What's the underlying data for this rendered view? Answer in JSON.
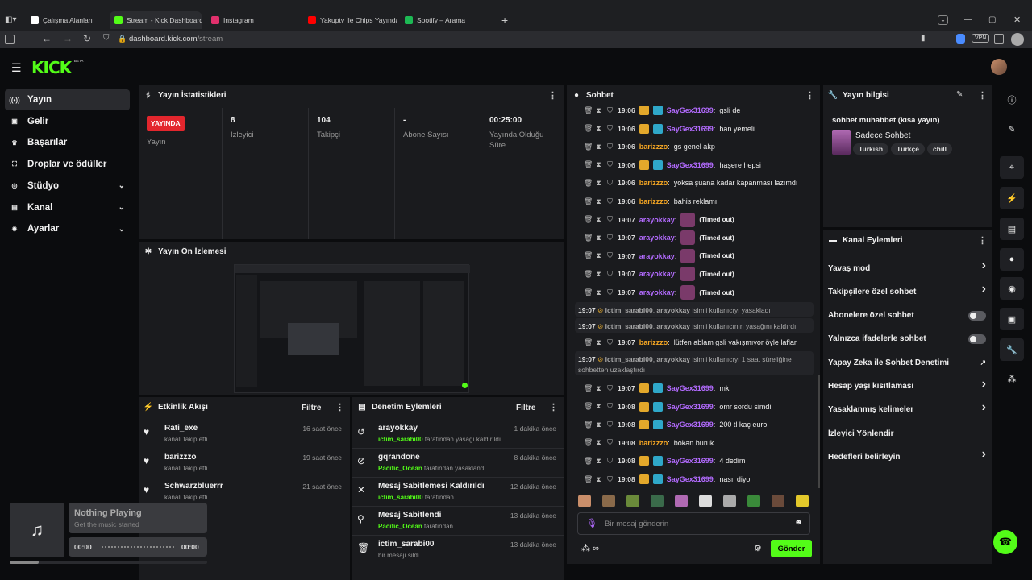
{
  "browser": {
    "tabs": [
      {
        "label": "Çalışma Alanları",
        "color": "#ffffff"
      },
      {
        "label": "Stream - Kick Dashboard",
        "color": "#53fc18"
      },
      {
        "label": "Instagram",
        "color": "#e1306c"
      },
      {
        "label": "Yakuptv İle Chips Yayında K",
        "color": "#ff0000"
      },
      {
        "label": "Spotify – Arama",
        "color": "#1db954"
      }
    ],
    "url_host": "dashboard.kick.com",
    "url_path": "/stream",
    "new_tab": "+",
    "vpn": "VPN"
  },
  "brand": {
    "logo": "KICK",
    "beta": "BETA",
    "accent": "#53fc18"
  },
  "sidebar": {
    "items": [
      {
        "label": "Yayın",
        "icon": "broadcast-icon",
        "glyph": "((•))"
      },
      {
        "label": "Gelir",
        "icon": "revenue-icon",
        "glyph": "▣"
      },
      {
        "label": "Başarılar",
        "icon": "trophy-icon",
        "glyph": "♛"
      },
      {
        "label": "Droplar ve ödüller",
        "icon": "gift-icon",
        "glyph": "⛶"
      },
      {
        "label": "Stüdyo",
        "icon": "studio-icon",
        "glyph": "◎"
      },
      {
        "label": "Kanal",
        "icon": "channel-icon",
        "glyph": "▤"
      },
      {
        "label": "Ayarlar",
        "icon": "settings-icon",
        "glyph": "✹"
      }
    ]
  },
  "stats": {
    "title": "Yayın İstatistikleri",
    "live_badge": "YAYINDA",
    "live_label": "Yayın",
    "items": [
      {
        "value": "8",
        "label": "İzleyici"
      },
      {
        "value": "104",
        "label": "Takipçi"
      },
      {
        "value": "-",
        "label": "Abone Sayısı"
      },
      {
        "value": "00:25:00",
        "label": "Yayında Olduğu Süre"
      }
    ]
  },
  "preview": {
    "title": "Yayın Ön İzlemesi"
  },
  "activity": {
    "title": "Etkinlik Akışı",
    "filter": "Filtre",
    "items": [
      {
        "name": "Rati_exe",
        "sub": "kanalı takip etti",
        "time": "16 saat önce"
      },
      {
        "name": "barizzzo",
        "sub": "kanalı takip etti",
        "time": "19 saat önce"
      },
      {
        "name": "Schwarzbluerrr",
        "sub": "kanalı takip etti",
        "time": "21 saat önce"
      }
    ]
  },
  "moderation": {
    "title": "Denetim Eylemleri",
    "filter": "Filtre",
    "items": [
      {
        "name": "arayokkay",
        "actor": "ictim_sarabi00",
        "sub": "tarafından yasağı kaldırıldı",
        "time": "1 dakika önce",
        "glyph": "↺"
      },
      {
        "name": "gqrandone",
        "actor": "Pacific_Ocean",
        "sub": "tarafından yasaklandı",
        "time": "8 dakika önce",
        "glyph": "⊘"
      },
      {
        "name": "Mesaj Sabitlemesi Kaldırıldı",
        "actor": "ictim_sarabi00",
        "sub": "tarafından",
        "time": "12 dakika önce",
        "glyph": "✕"
      },
      {
        "name": "Mesaj Sabitlendi",
        "actor": "Pacific_Ocean",
        "sub": "tarafından",
        "time": "13 dakika önce",
        "glyph": "⚲"
      },
      {
        "name": "ictim_sarabi00",
        "actor": "",
        "sub": "bir mesajı sildi",
        "time": "13 dakika önce",
        "glyph": "🗑"
      }
    ]
  },
  "chat": {
    "title": "Sohbet",
    "input_placeholder": "Bir mesaj gönderin",
    "send": "Gönder",
    "lines": [
      {
        "time": "19:06",
        "user": "SayGex31699",
        "color": "#b36bff",
        "badges": true,
        "msg": "gsli de"
      },
      {
        "time": "19:06",
        "user": "SayGex31699",
        "color": "#b36bff",
        "badges": true,
        "msg": "ban yemeli"
      },
      {
        "time": "19:06",
        "user": "barizzzo",
        "color": "#f5a623",
        "badges": false,
        "msg": "gs genel akp"
      },
      {
        "time": "19:06",
        "user": "SayGex31699",
        "color": "#b36bff",
        "badges": true,
        "msg": "haşere hepsi"
      },
      {
        "time": "19:06",
        "user": "barizzzo",
        "color": "#f5a623",
        "badges": false,
        "msg": "yoksa şuana kadar kapanması lazımdı"
      },
      {
        "time": "19:06",
        "user": "barizzzo",
        "color": "#f5a623",
        "badges": false,
        "msg": "bahis reklamı"
      },
      {
        "time": "19:07",
        "user": "arayokkay",
        "color": "#b36bff",
        "badges": false,
        "msg": "(Timed out)",
        "timed": true
      },
      {
        "time": "19:07",
        "user": "arayokkay",
        "color": "#b36bff",
        "badges": false,
        "msg": "(Timed out)",
        "timed": true
      },
      {
        "time": "19:07",
        "user": "arayokkay",
        "color": "#b36bff",
        "badges": false,
        "msg": "(Timed out)",
        "timed": true
      },
      {
        "time": "19:07",
        "user": "arayokkay",
        "color": "#b36bff",
        "badges": false,
        "msg": "(Timed out)",
        "timed": true
      },
      {
        "time": "19:07",
        "user": "arayokkay",
        "color": "#b36bff",
        "badges": false,
        "msg": "(Timed out)",
        "timed": true
      }
    ],
    "sys1": {
      "time": "19:07",
      "actor": "ictim_sarabi00",
      "target": "arayokkay",
      "text": "isimli kullanıcıyı yasakladı"
    },
    "sys2": {
      "time": "19:07",
      "actor": "ictim_sarabi00",
      "target": "arayokkay",
      "text": "isimli kullanıcının yasağını kaldırdı"
    },
    "mid": {
      "time": "19:07",
      "user": "barizzzo",
      "msg": "lütfen ablam gsli yakışmıyor öyle laflar"
    },
    "sys3": {
      "time": "19:07",
      "actor": "ictim_sarabi00",
      "target": "arayokkay",
      "text": "isimli kullanıcıyı 1 saat süreliğine sohbetten uzaklaştırdı"
    },
    "lines2": [
      {
        "time": "19:07",
        "user": "SayGex31699",
        "color": "#b36bff",
        "badges": true,
        "msg": "mk"
      },
      {
        "time": "19:08",
        "user": "SayGex31699",
        "color": "#b36bff",
        "badges": true,
        "msg": "omr sordu simdi"
      },
      {
        "time": "19:08",
        "user": "SayGex31699",
        "color": "#b36bff",
        "badges": true,
        "msg": "200 tl kaç euro"
      },
      {
        "time": "19:08",
        "user": "barizzzo",
        "color": "#f5a623",
        "badges": false,
        "msg": "bokan buruk"
      },
      {
        "time": "19:08",
        "user": "SayGex31699",
        "color": "#b36bff",
        "badges": true,
        "msg": "4 dedim"
      },
      {
        "time": "19:08",
        "user": "SayGex31699",
        "color": "#b36bff",
        "badges": true,
        "msg": "nasıl diyo"
      }
    ]
  },
  "info": {
    "title": "Yayın bilgisi",
    "stream_title": "sohbet muhabbet (kısa yayın)",
    "category": "Sadece Sohbet",
    "tags": [
      "Turkish",
      "Türkçe",
      "chill"
    ]
  },
  "channel_actions": {
    "title": "Kanal Eylemleri",
    "items": [
      {
        "label": "Yavaş mod",
        "kind": "arrow"
      },
      {
        "label": "Takipçilere özel sohbet",
        "kind": "arrow"
      },
      {
        "label": "Abonelere özel sohbet",
        "kind": "toggle"
      },
      {
        "label": "Yalnızca ifadelerle sohbet",
        "kind": "toggle"
      },
      {
        "label": "Yapay Zeka ile Sohbet Denetimi",
        "kind": "external"
      },
      {
        "label": "Hesap yaşı kısıtlaması",
        "kind": "arrow"
      },
      {
        "label": "Yasaklanmış kelimeler",
        "kind": "arrow"
      },
      {
        "label": "İzleyici Yönlendir",
        "kind": "none"
      },
      {
        "label": "Hedefleri belirleyin",
        "kind": "arrow"
      }
    ]
  },
  "player": {
    "title": "Nothing Playing",
    "subtitle": "Get the music started",
    "elapsed": "00:00",
    "total": "00:00"
  }
}
